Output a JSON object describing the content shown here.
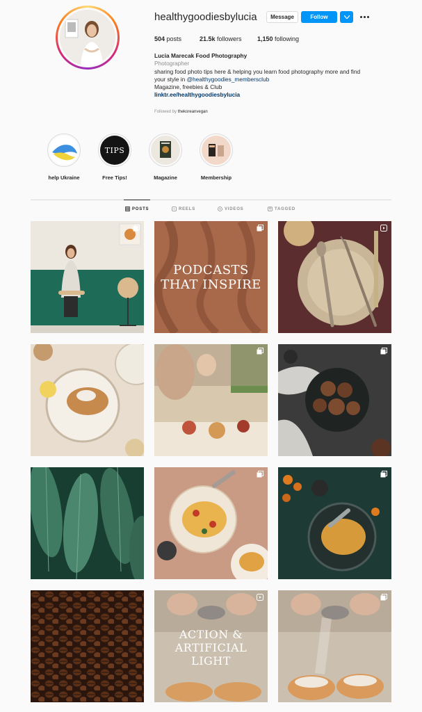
{
  "profile": {
    "username": "healthygoodiesbylucia",
    "message_label": "Message",
    "follow_label": "Follow",
    "stats": {
      "posts_count": "504",
      "posts_label": "posts",
      "followers_count": "21.5k",
      "followers_label": "followers",
      "following_count": "1,150",
      "following_label": "following"
    },
    "bio": {
      "full_name": "Lucia Marecak Food Photography",
      "category": "Photographer",
      "line1": "sharing food photo tips here & helping you learn food photography more and find",
      "line2_prefix": "your style in ",
      "mention": "@healthygoodies_membersclub",
      "line3": "Magazine, freebies & Club",
      "link": "linktr.ee/healthygoodiesbylucia"
    },
    "followed_by_prefix": "Followed by",
    "followed_by_user": "thekoreanvegan"
  },
  "highlights": [
    {
      "label": "help Ukraine"
    },
    {
      "label": "Free Tips!",
      "cover_text": "TIPS"
    },
    {
      "label": "Magazine"
    },
    {
      "label": "Membership"
    }
  ],
  "tabs": [
    {
      "label": "POSTS",
      "icon": "grid-icon",
      "active": true
    },
    {
      "label": "REELS",
      "icon": "reels-icon",
      "active": false
    },
    {
      "label": "VIDEOS",
      "icon": "video-icon",
      "active": false
    },
    {
      "label": "TAGGED",
      "icon": "tag-icon",
      "active": false
    }
  ],
  "posts": [
    {
      "type": "photo",
      "subject": "woman on chair",
      "badge": "multi"
    },
    {
      "type": "text",
      "text_line1": "PODCASTS",
      "text_line2": "THAT INSPIRE",
      "badge": "multi"
    },
    {
      "type": "photo",
      "subject": "cutlery on plate",
      "badge": "reel"
    },
    {
      "type": "photo",
      "subject": "toast plate",
      "badge": "none"
    },
    {
      "type": "photo",
      "subject": "picnic",
      "badge": "multi"
    },
    {
      "type": "photo",
      "subject": "cinnamon rolls",
      "badge": "multi"
    },
    {
      "type": "photo",
      "subject": "green leaves",
      "badge": "none"
    },
    {
      "type": "photo",
      "subject": "pasta",
      "badge": "multi"
    },
    {
      "type": "photo",
      "subject": "pasta dark",
      "badge": "multi"
    },
    {
      "type": "photo",
      "subject": "coffee beans",
      "badge": "none"
    },
    {
      "type": "text",
      "text_line1": "ACTION &",
      "text_line2": "ARTIFICIAL",
      "text_line3": "LIGHT",
      "badge": "reel"
    },
    {
      "type": "photo",
      "subject": "croissants sugar",
      "badge": "multi"
    }
  ],
  "colors": {
    "follow_blue": "#0095f6",
    "link_blue": "#00376b",
    "muted_gray": "#8e8e8e"
  }
}
